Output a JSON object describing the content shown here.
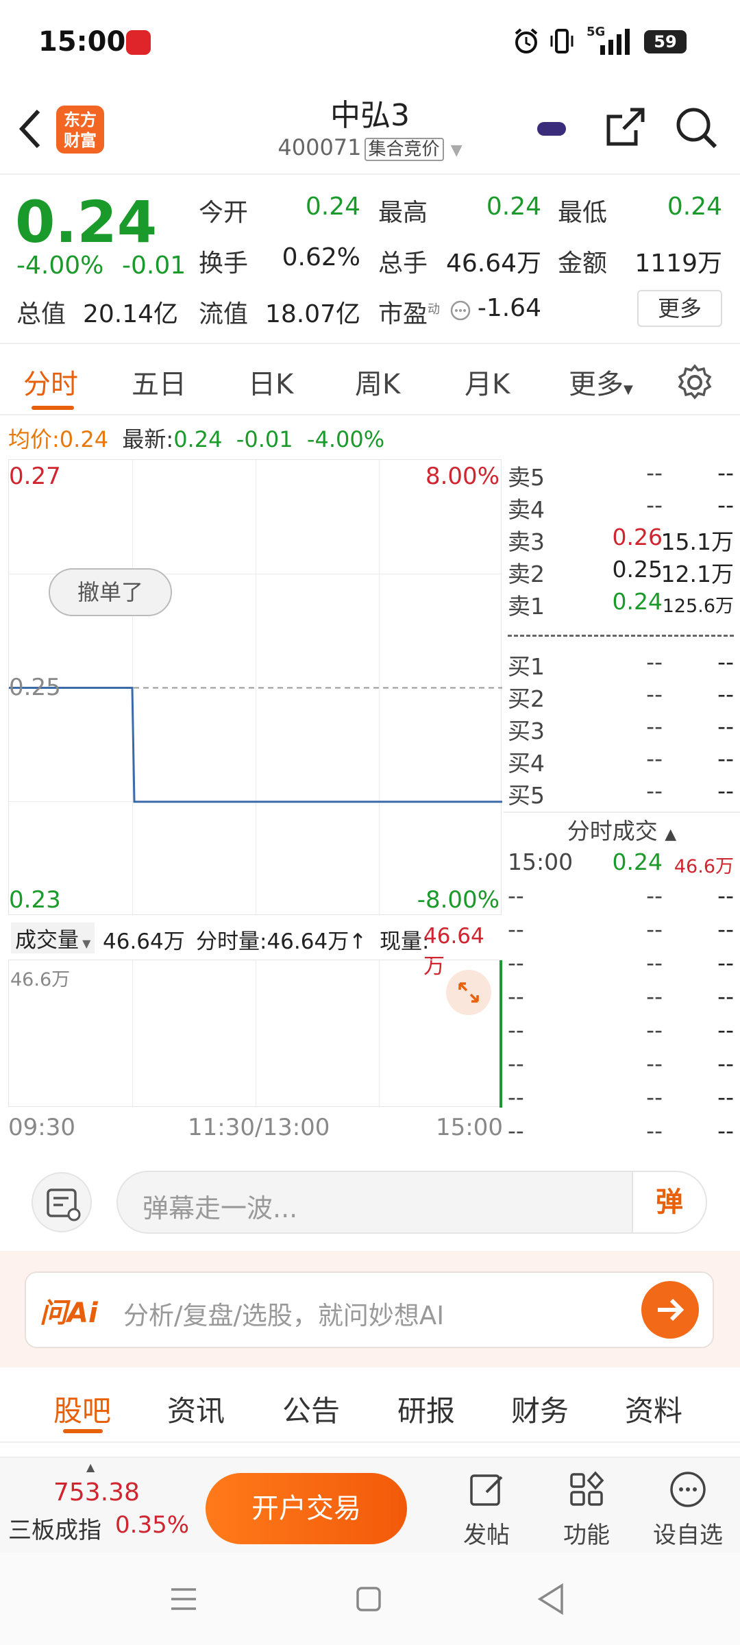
{
  "status": {
    "time": "15:00",
    "battery": "59",
    "network": "5G"
  },
  "header": {
    "brand_line1": "东方",
    "brand_line2": "财富",
    "name": "中弘3",
    "code": "400071",
    "tag": "集合竞价"
  },
  "quote": {
    "price": "0.24",
    "change_pct": "-4.00%",
    "change": "-0.01",
    "open_label": "今开",
    "open": "0.24",
    "high_label": "最高",
    "high": "0.24",
    "low_label": "最低",
    "low": "0.24",
    "turnover_label": "换手",
    "turnover": "0.62%",
    "volume_label": "总手",
    "volume": "46.64万",
    "amount_label": "金额",
    "amount": "1119万",
    "mktcap_label": "总值",
    "mktcap": "20.14亿",
    "float_label": "流值",
    "float": "18.07亿",
    "pe_label": "市盈",
    "pe_sup": "动",
    "pe": "-1.64",
    "more": "更多"
  },
  "period_tabs": [
    "分时",
    "五日",
    "日K",
    "周K",
    "月K",
    "更多"
  ],
  "avg_line": {
    "avg_label": "均价:",
    "avg": "0.24",
    "new_label": "最新:",
    "new": "0.24",
    "chg": "-0.01",
    "pct": "-4.00%"
  },
  "chart": {
    "y_top": "0.27",
    "y_mid": "0.25",
    "y_bot": "0.23",
    "pct_top": "8.00%",
    "pct_bot": "-8.00%",
    "cancel_label": "撤单了",
    "vol_label": "成交量",
    "vol_total": "46.64万",
    "vol_min_label": "分时量:46.64万↑",
    "vol_now_label": "现量:",
    "vol_now": "46.64万",
    "vol_max": "46.6万",
    "x_start": "09:30",
    "x_mid": "11:30/13:00",
    "x_end": "15:00"
  },
  "chart_data": {
    "type": "line",
    "x": [
      "09:30",
      "10:30",
      "10:31",
      "15:00"
    ],
    "values": [
      0.25,
      0.25,
      0.24,
      0.24
    ],
    "ylim": [
      0.23,
      0.27
    ]
  },
  "orderbook": {
    "asks": [
      {
        "label": "卖5",
        "price": "--",
        "vol": "--"
      },
      {
        "label": "卖4",
        "price": "--",
        "vol": "--"
      },
      {
        "label": "卖3",
        "price": "0.26",
        "vol": "15.1万"
      },
      {
        "label": "卖2",
        "price": "0.25",
        "vol": "12.1万"
      },
      {
        "label": "卖1",
        "price": "0.24",
        "vol": "125.6万"
      }
    ],
    "bids": [
      {
        "label": "买1",
        "price": "--",
        "vol": "--"
      },
      {
        "label": "买2",
        "price": "--",
        "vol": "--"
      },
      {
        "label": "买3",
        "price": "--",
        "vol": "--"
      },
      {
        "label": "买4",
        "price": "--",
        "vol": "--"
      },
      {
        "label": "买5",
        "price": "--",
        "vol": "--"
      }
    ],
    "trades_title": "分时成交",
    "trades": [
      {
        "time": "15:00",
        "price": "0.24",
        "vol": "46.6万"
      },
      {
        "time": "--",
        "price": "--",
        "vol": "--"
      },
      {
        "time": "--",
        "price": "--",
        "vol": "--"
      },
      {
        "time": "--",
        "price": "--",
        "vol": "--"
      },
      {
        "time": "--",
        "price": "--",
        "vol": "--"
      },
      {
        "time": "--",
        "price": "--",
        "vol": "--"
      },
      {
        "time": "--",
        "price": "--",
        "vol": "--"
      },
      {
        "time": "--",
        "price": "--",
        "vol": "--"
      },
      {
        "time": "--",
        "price": "--",
        "vol": "--"
      }
    ]
  },
  "danmu": {
    "placeholder": "弹幕走一波...",
    "send": "弹"
  },
  "ai": {
    "logo": "问Ai",
    "placeholder": "分析/复盘/选股，就问妙想AI"
  },
  "content_tabs": [
    "股吧",
    "资讯",
    "公告",
    "研报",
    "财务",
    "资料"
  ],
  "bottom": {
    "index_value": "753.38",
    "index_name": "三板成指",
    "index_pct": "0.35%",
    "open_account": "开户交易",
    "post": "发帖",
    "functions": "功能",
    "watch": "设自选"
  }
}
